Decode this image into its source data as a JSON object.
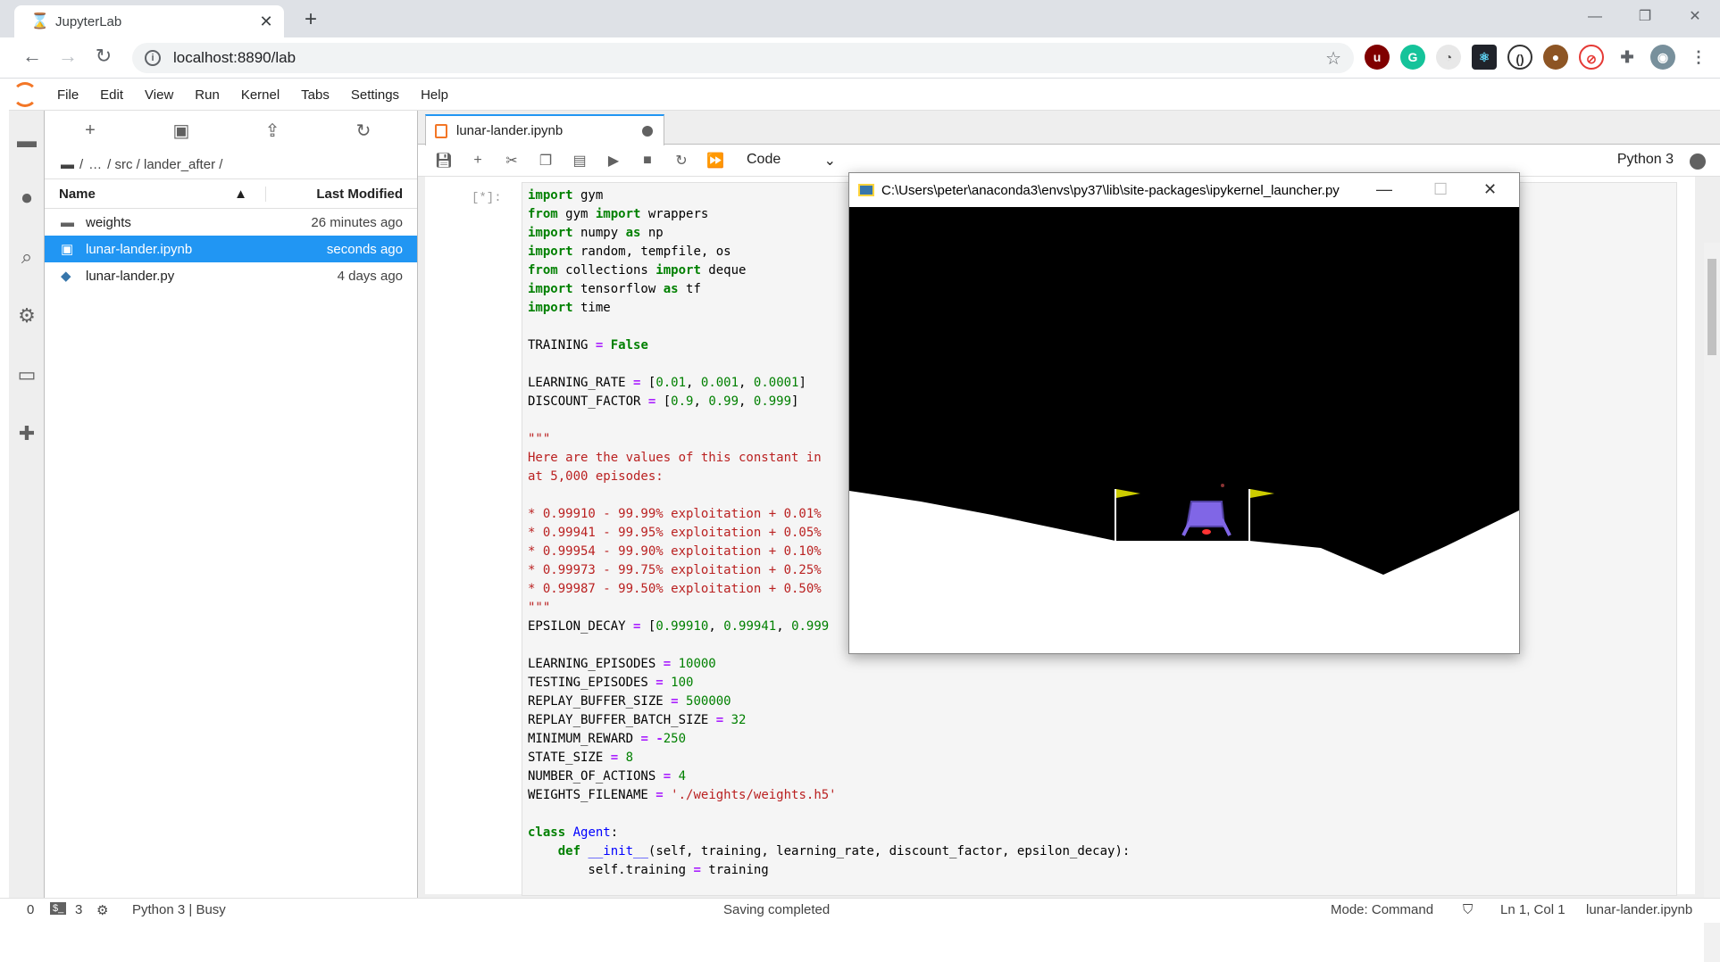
{
  "browser": {
    "tab_title": "JupyterLab",
    "url": "localhost:8890/lab",
    "window_controls": [
      "minimize-icon",
      "restore-icon",
      "close-icon"
    ]
  },
  "jupyter_menu": [
    "File",
    "Edit",
    "View",
    "Run",
    "Kernel",
    "Tabs",
    "Settings",
    "Help"
  ],
  "filebrowser": {
    "breadcrumb": [
      "/",
      "…",
      "/ src / lander_after /"
    ],
    "header_name": "Name",
    "header_modified": "Last Modified",
    "files": [
      {
        "name": "weights",
        "modified": "26 minutes ago",
        "type": "folder",
        "selected": false
      },
      {
        "name": "lunar-lander.ipynb",
        "modified": "seconds ago",
        "type": "notebook",
        "selected": true
      },
      {
        "name": "lunar-lander.py",
        "modified": "4 days ago",
        "type": "python",
        "selected": false
      }
    ]
  },
  "notebook": {
    "tab_title": "lunar-lander.ipynb",
    "cell_type": "Code",
    "kernel": "Python 3",
    "prompt": "[*]:"
  },
  "gym_window": {
    "title": "C:\\Users\\peter\\anaconda3\\envs\\py37\\lib\\site-packages\\ipykernel_launcher.py"
  },
  "status": {
    "terminals": "0",
    "kernels": "3",
    "kernel_state": "Python 3 | Busy",
    "message": "Saving completed",
    "mode": "Mode: Command",
    "cursor": "Ln 1, Col 1",
    "file": "lunar-lander.ipynb"
  },
  "colors": {
    "accent": "#2196f3",
    "jupyter_orange": "#f37626",
    "keyword": "#008000",
    "operator": "#aa22ff",
    "string": "#ba2121"
  }
}
